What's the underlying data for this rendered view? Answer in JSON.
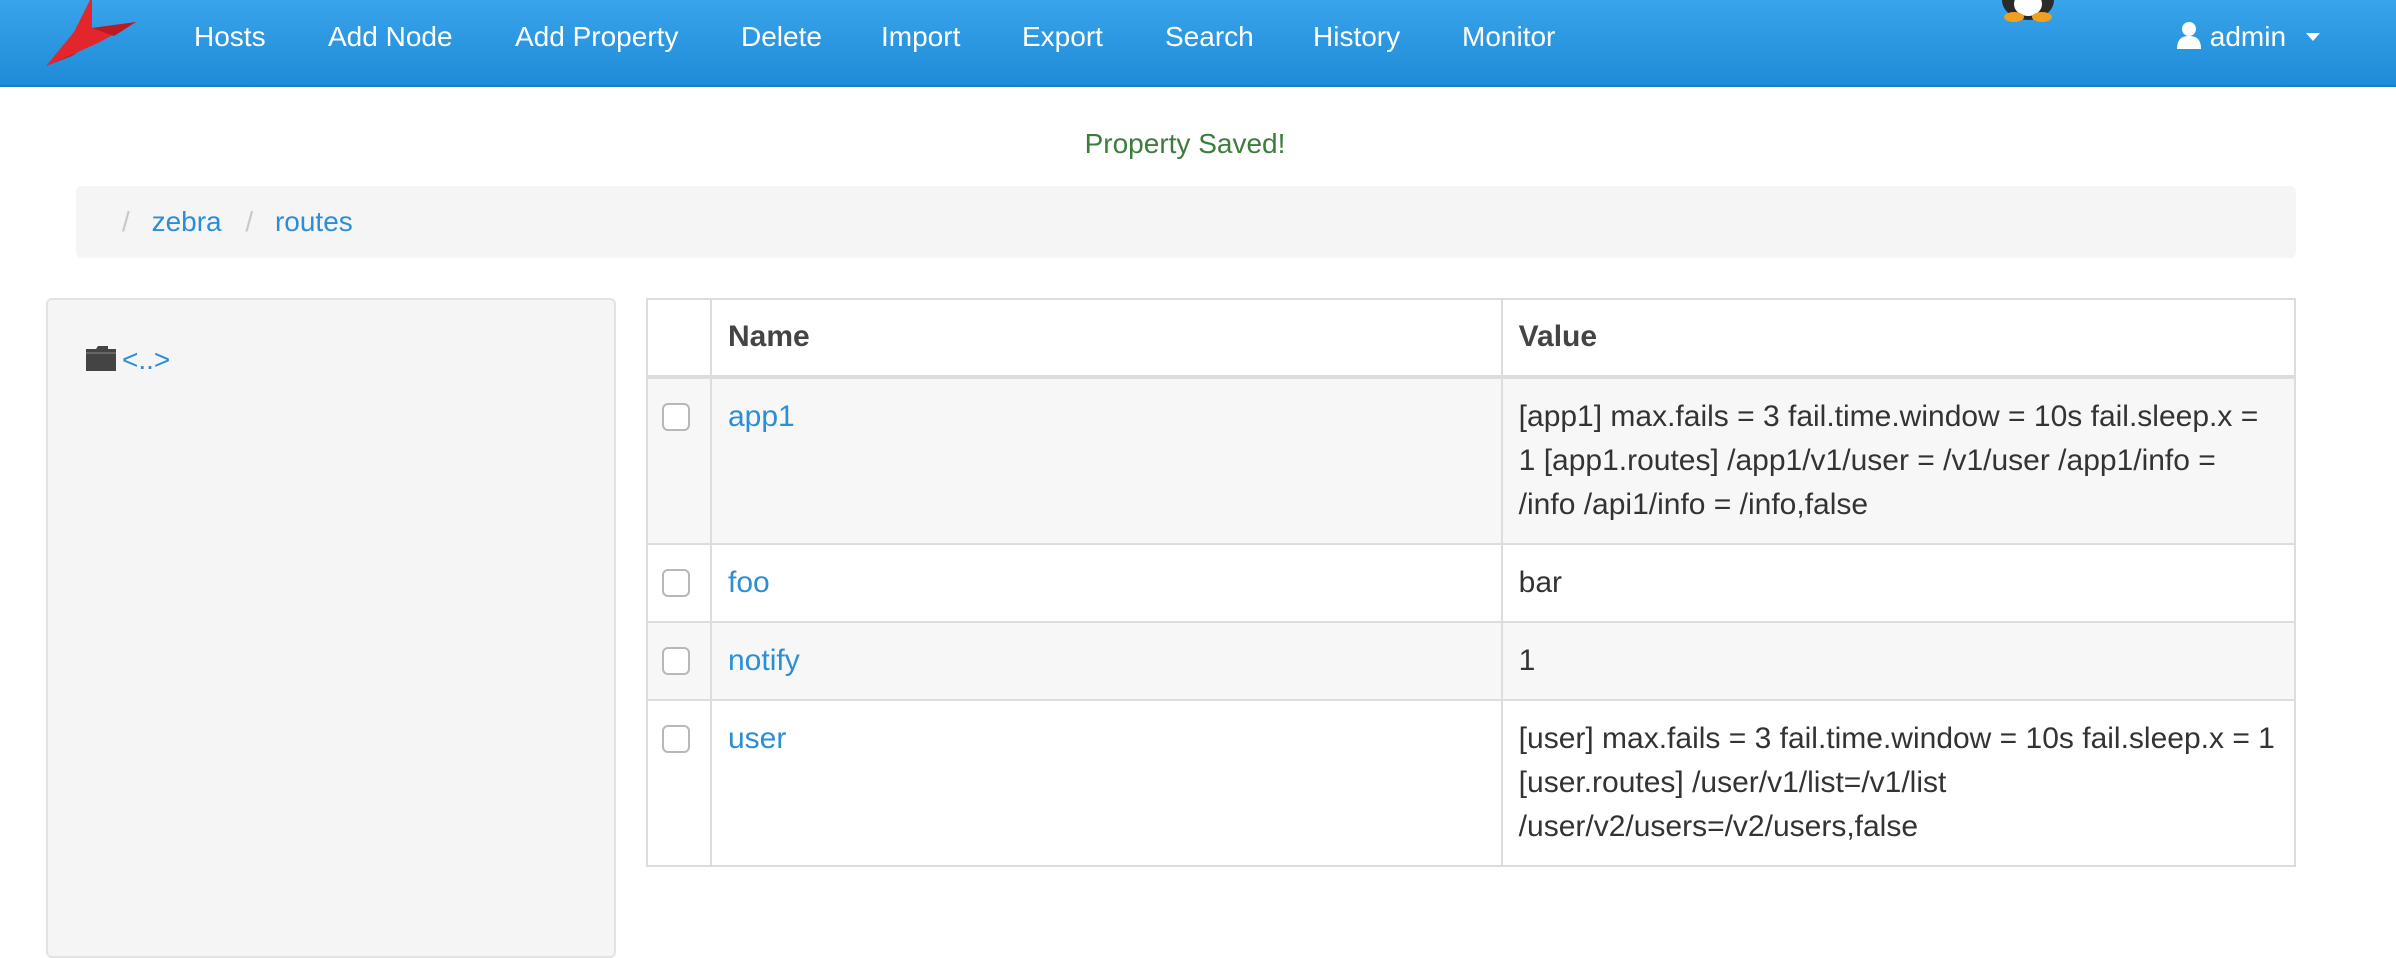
{
  "navbar": {
    "items": [
      {
        "label": "Hosts"
      },
      {
        "label": "Add Node"
      },
      {
        "label": "Add Property"
      },
      {
        "label": "Delete"
      },
      {
        "label": "Import"
      },
      {
        "label": "Export"
      },
      {
        "label": "Search"
      },
      {
        "label": "History"
      },
      {
        "label": "Monitor"
      }
    ],
    "user": {
      "label": "admin",
      "icon": "user-icon"
    },
    "brand_color": "#2b96e0"
  },
  "status": {
    "message": "Property Saved!",
    "color": "#3c7d3c"
  },
  "breadcrumb": {
    "items": [
      {
        "label": "zebra"
      },
      {
        "label": "routes"
      }
    ]
  },
  "sidebar": {
    "parent": {
      "label": "<..>",
      "icon": "folder-icon"
    }
  },
  "table": {
    "columns": {
      "name": "Name",
      "value": "Value"
    },
    "rows": [
      {
        "name": "app1",
        "value": "[app1] max.fails = 3 fail.time.window = 10s fail.sleep.x = 1 [app1.routes] /app1/v1/user = /v1/user /app1/info = /info /api1/info = /info,false"
      },
      {
        "name": "foo",
        "value": "bar"
      },
      {
        "name": "notify",
        "value": "1"
      },
      {
        "name": "user",
        "value": "[user] max.fails = 3 fail.time.window = 10s fail.sleep.x = 1 [user.routes] /user/v1/list=/v1/list /user/v2/users=/v2/users,false"
      }
    ]
  }
}
